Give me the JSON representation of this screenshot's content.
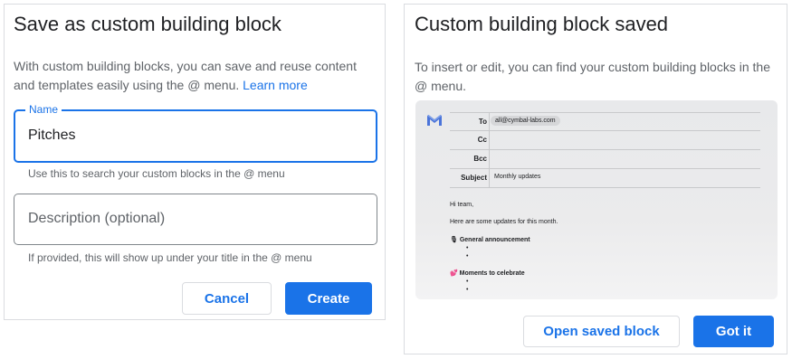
{
  "save_dialog": {
    "title": "Save as custom building block",
    "description": "With custom building blocks, you can save and reuse content and templates easily using the @ menu.",
    "learn_more": "Learn more",
    "name_field": {
      "label": "Name",
      "value": "Pitches",
      "helper": "Use this to search your custom blocks in the @ menu"
    },
    "description_field": {
      "placeholder": "Description (optional)",
      "helper": "If provided, this will show up under your title in the @ menu"
    },
    "cancel_label": "Cancel",
    "create_label": "Create"
  },
  "saved_dialog": {
    "title": "Custom building block saved",
    "description": "To insert or edit, you can find your custom building blocks in the @ menu.",
    "preview": {
      "icon": "gmail-icon",
      "to_label": "To",
      "to_value": "all@cymbal-labs.com",
      "cc_label": "Cc",
      "bcc_label": "Bcc",
      "subject_label": "Subject",
      "subject_value": "Monthly updates",
      "greeting": "Hi team,",
      "intro": "Here are some updates for this month.",
      "section1_icon": "🎙",
      "section1": "General announcement",
      "section2_icon": "💕",
      "section2": "Moments to celebrate",
      "bullet": "•"
    },
    "open_label": "Open saved block",
    "got_it_label": "Got it"
  },
  "colors": {
    "accent": "#1a73e8",
    "border": "#dadce0",
    "text_secondary": "#5f6368"
  }
}
